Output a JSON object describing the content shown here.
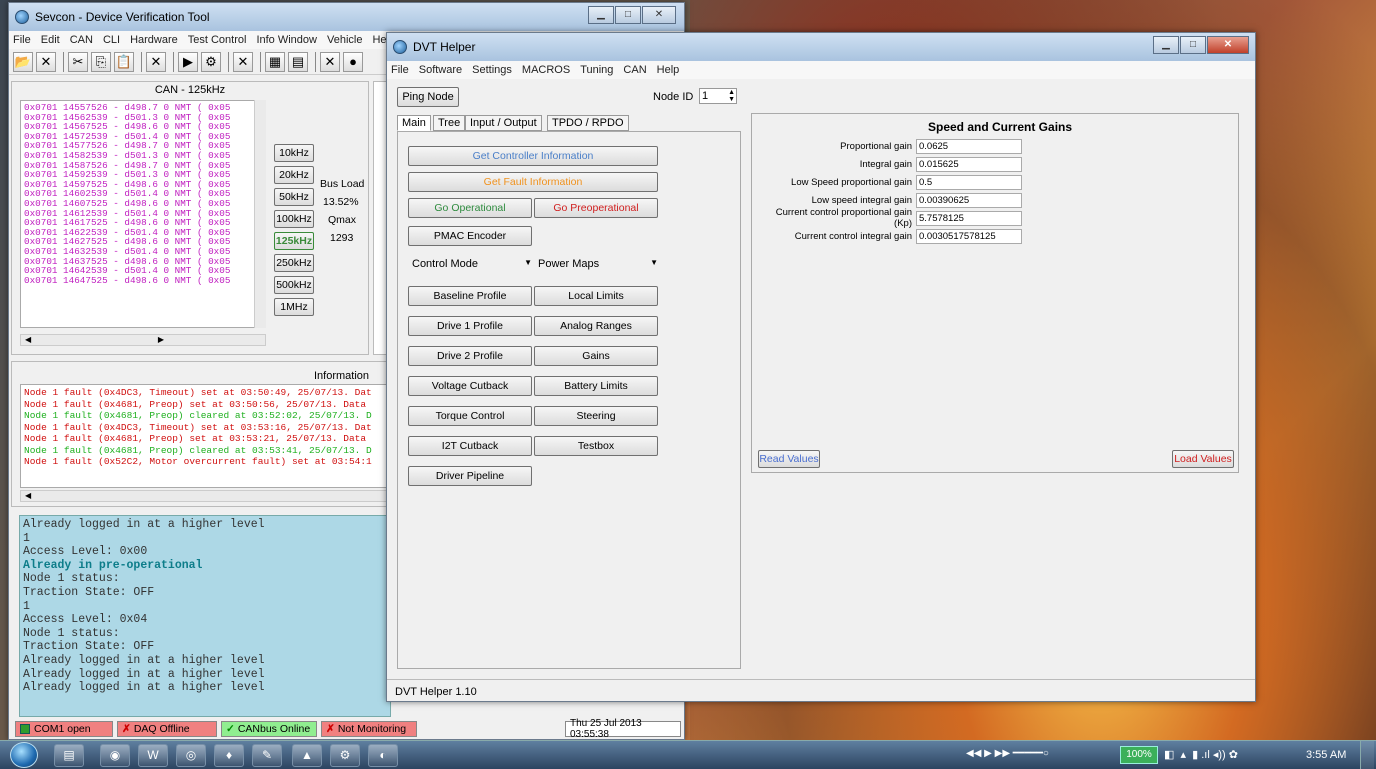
{
  "main_window": {
    "title": "Sevcon - Device Verification Tool",
    "menu": [
      "File",
      "Edit",
      "CAN",
      "CLI",
      "Hardware",
      "Test Control",
      "Info Window",
      "Vehicle",
      "Hel"
    ],
    "can_panel_title": "CAN - 125kHz",
    "can_log": [
      "0x0701 14557526 - d498.7 0 NMT ( 0x05",
      "0x0701 14562539 - d501.3 0 NMT ( 0x05",
      "0x0701 14567525 - d498.6 0 NMT ( 0x05",
      "0x0701 14572539 - d501.4 0 NMT ( 0x05",
      "0x0701 14577526 - d498.7 0 NMT ( 0x05",
      "0x0701 14582539 - d501.3 0 NMT ( 0x05",
      "0x0701 14587526 - d498.7 0 NMT ( 0x05",
      "0x0701 14592539 - d501.3 0 NMT ( 0x05",
      "0x0701 14597525 - d498.6 0 NMT ( 0x05",
      "0x0701 14602539 - d501.4 0 NMT ( 0x05",
      "0x0701 14607525 - d498.6 0 NMT ( 0x05",
      "0x0701 14612539 - d501.4 0 NMT ( 0x05",
      "0x0701 14617525 - d498.6 0 NMT ( 0x05",
      "0x0701 14622539 - d501.4 0 NMT ( 0x05",
      "0x0701 14627525 - d498.6 0 NMT ( 0x05",
      "0x0701 14632539 - d501.4 0 NMT ( 0x05",
      "0x0701 14637525 - d498.6 0 NMT ( 0x05",
      "0x0701 14642539 - d501.4 0 NMT ( 0x05",
      "0x0701 14647525 - d498.6 0 NMT ( 0x05"
    ],
    "baud_buttons": [
      "10kHz",
      "20kHz",
      "50kHz",
      "100kHz",
      "125kHz",
      "250kHz",
      "500kHz",
      "1MHz"
    ],
    "bus_load_label": "Bus Load",
    "bus_load_value": "13.52%",
    "qmax_label": "Qmax",
    "qmax_value": "1293",
    "info_title": "Information",
    "info_log": [
      {
        "text": "Node 1 fault (0x4DC3, Timeout) set at 03:50:49, 25/07/13. Dat",
        "color": "#d01010"
      },
      {
        "text": "Node 1 fault (0x4681, Preop) set at 03:50:56, 25/07/13. Data",
        "color": "#d01010"
      },
      {
        "text": "Node 1 fault (0x4681, Preop) cleared at 03:52:02, 25/07/13. D",
        "color": "#20b020"
      },
      {
        "text": "Node 1 fault (0x4DC3, Timeout) set at 03:53:16, 25/07/13. Dat",
        "color": "#d01010"
      },
      {
        "text": "Node 1 fault (0x4681, Preop) set at 03:53:21, 25/07/13. Data",
        "color": "#d01010"
      },
      {
        "text": "Node 1 fault (0x4681, Preop) cleared at 03:53:41, 25/07/13. D",
        "color": "#20b020"
      },
      {
        "text": "Node 1 fault (0x52C2, Motor overcurrent fault) set at 03:54:1",
        "color": "#d01010"
      }
    ],
    "cli_log": [
      {
        "text": "Already logged in at a higher level",
        "style": "normal"
      },
      {
        "text": "1",
        "style": "normal"
      },
      {
        "text": "Access Level: 0x00",
        "style": "normal"
      },
      {
        "text": "Already in pre-operational",
        "style": "bold"
      },
      {
        "text": "Node 1 status:",
        "style": "normal"
      },
      {
        "text": "Traction State: OFF",
        "style": "normal"
      },
      {
        "text": "1",
        "style": "normal"
      },
      {
        "text": "Access Level: 0x04",
        "style": "normal"
      },
      {
        "text": "Node 1 status:",
        "style": "normal"
      },
      {
        "text": "Traction State: OFF",
        "style": "normal"
      },
      {
        "text": "Already logged in at a higher level",
        "style": "normal"
      },
      {
        "text": "Already logged in at a higher level",
        "style": "normal"
      },
      {
        "text": "Already logged in at a higher level",
        "style": "normal"
      }
    ],
    "status": {
      "com": "COM1 open",
      "daq": "DAQ Offline",
      "canbus": "CANbus Online",
      "monitor": "Not Monitoring",
      "datetime": "Thu 25 Jul 2013  03:55:38"
    },
    "colors": {
      "com": "#2e9b2e",
      "daq": "#f08080",
      "canbus": "#90ee90",
      "monitor": "#f08080"
    }
  },
  "helper": {
    "title": "DVT Helper",
    "menu": [
      "File",
      "Software",
      "Settings",
      "MACROS",
      "Tuning",
      "CAN",
      "Help"
    ],
    "ping_label": "Ping Node",
    "node_id_label": "Node ID",
    "node_id_value": "1",
    "tabs": [
      "Main",
      "Tree",
      "Input / Output",
      "TPDO / RPDO"
    ],
    "buttons": {
      "get_controller_info": "Get Controller Information",
      "get_fault_info": "Get Fault Information",
      "go_operational": "Go Operational",
      "go_preoperational": "Go Preoperational",
      "pmac_encoder": "PMAC Encoder",
      "control_mode": "Control Mode",
      "power_maps": "Power Maps",
      "baseline_profile": "Baseline Profile",
      "local_limits": "Local Limits",
      "drive1_profile": "Drive 1 Profile",
      "analog_ranges": "Analog Ranges",
      "drive2_profile": "Drive 2 Profile",
      "gains": "Gains",
      "voltage_cutback": "Voltage Cutback",
      "battery_limits": "Battery Limits",
      "torque_control": "Torque Control",
      "steering": "Steering",
      "i2t_cutback": "I2T Cutback",
      "testbox": "Testbox",
      "driver_pipeline": "Driver Pipeline",
      "read_values": "Read Values",
      "load_values": "Load Values"
    },
    "gains_title": "Speed and Current Gains",
    "gains": [
      {
        "label": "Proportional gain",
        "value": "0.0625",
        "color": "#000"
      },
      {
        "label": "Integral gain",
        "value": "0.015625",
        "color": "#000"
      },
      {
        "label": "Low Speed proportional gain",
        "value": "0.5",
        "color": "#000"
      },
      {
        "label": "Low speed integral gain",
        "value": "0.00390625",
        "color": "#000"
      },
      {
        "label": "Current control proportional gain (Kp)",
        "value": "5.7578125",
        "color": "#000"
      },
      {
        "label": "Current control integral gain",
        "value": "0.0030517578125",
        "color": "#000"
      }
    ],
    "version": "DVT Helper 1.10",
    "colors": {
      "controller": "#4a7fc8",
      "fault": "#f0921e",
      "operational": "#2e8b3e",
      "preop": "#d02020",
      "read": "#4a6fd0",
      "load": "#d02020"
    }
  },
  "taskbar": {
    "zoom": "100%",
    "clock": "3:55 AM"
  }
}
